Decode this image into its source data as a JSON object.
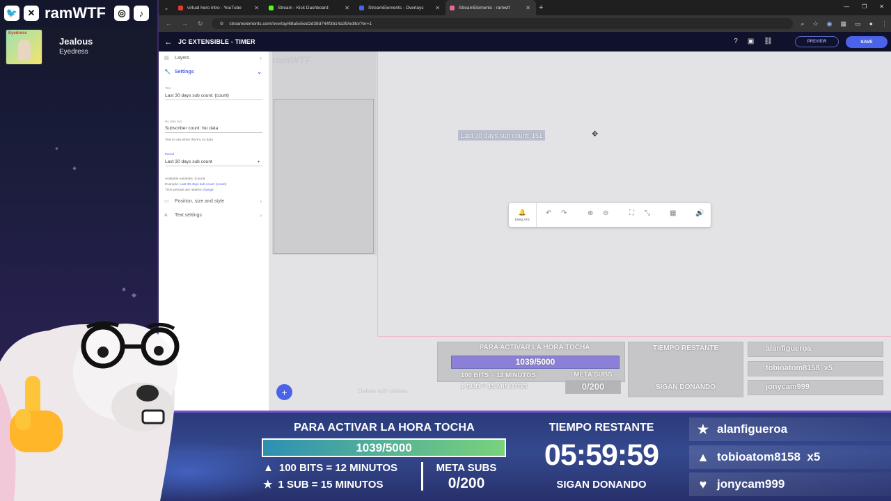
{
  "stream": {
    "brand_name": "ramWTF",
    "song_title": "Jealous",
    "song_artist": "Eyedress",
    "album_cover_text": "Eyedress"
  },
  "browser": {
    "tabs": [
      {
        "label": "virtual hero intro - YouTube",
        "color": "#e53935"
      },
      {
        "label": "Stream - Kick Dashboard",
        "color": "#53fc18"
      },
      {
        "label": "StreamElements - Overlays",
        "color": "#4b63e8"
      },
      {
        "label": "StreamElements - ramwtf",
        "color": "#e46c8a"
      }
    ],
    "url": "streamelements.com/overlay/68a5e5ed2d38d744f3b14a39/editor?er=1"
  },
  "editor": {
    "title": "JC EXTENSIBLE - TIMER",
    "preview_label": "PREVIEW",
    "save_label": "SAVE",
    "panel": {
      "layers_label": "Layers",
      "settings_label": "Settings",
      "text_label": "Text",
      "text_value": "Last 30 days sub count: {count}",
      "nodata_label": "No data text",
      "nodata_value": "Subscriber count: No data",
      "nodata_hint": "Text to use when there's no data",
      "period_label": "Period",
      "period_value": "Last 30 days sub count",
      "vars_hint": "Available variables: {count}",
      "example_prefix": "Example:",
      "example_value": "Last 30 days sub count: {count}",
      "relative_prefix": "Time periods are relative",
      "relative_link": "change",
      "position_label": "Position, size and style",
      "textsettings_label": "Text settings"
    },
    "canvas": {
      "widget_text": "Last 30 days sub count: 151",
      "emulate_label": "EMULATE",
      "delete_hint": "Delete with delete",
      "ghost_brand": "ramWTF"
    }
  },
  "overlay": {
    "goal_title": "PARA ACTIVAR LA HORA TOCHA",
    "goal_progress": "1039/5000",
    "goal_progress_fraction": 0.2078,
    "rule_bits": "100 BITS = 12 MINUTOS",
    "rule_sub": "1 SUB = 15 MINUTOS",
    "meta_label": "META SUBS",
    "meta_value": "0/200",
    "timer_label": "TIEMPO RESTANTE",
    "timer_value": "05:59:59",
    "cta": "SIGAN DONANDO",
    "recent_users": [
      {
        "icon": "star-icon",
        "name": "alanfigueroa"
      },
      {
        "icon": "triangle-icon",
        "name": "tobioatom8158  x5"
      },
      {
        "icon": "heart-icon",
        "name": "jonycam999"
      }
    ],
    "colors": {
      "accent": "#4b63e8",
      "bar_start": "#2e8fb4",
      "bar_end": "#79d27b",
      "frame": "#7b4fd0"
    }
  }
}
